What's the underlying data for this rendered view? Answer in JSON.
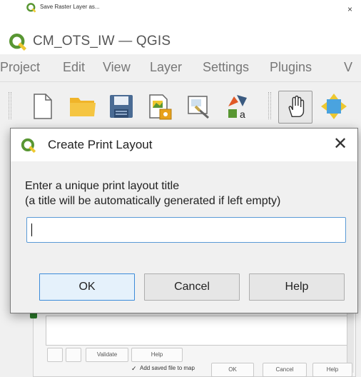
{
  "background_window": {
    "title": "Save Raster Layer as...",
    "close_glyph": "×",
    "buttons": {
      "validate": "Validate",
      "help_small": "Help",
      "ok": "OK",
      "cancel": "Cancel",
      "help": "Help"
    },
    "add_saved_file_checkbox": {
      "label": "Add saved file to map",
      "checked": true,
      "glyph": "✓"
    }
  },
  "qgis_window": {
    "title": "CM_OTS_IW — QGIS",
    "menu": [
      {
        "label": "Project"
      },
      {
        "label": "Edit"
      },
      {
        "label": "View"
      },
      {
        "label": "Layer"
      },
      {
        "label": "Settings"
      },
      {
        "label": "Plugins"
      },
      {
        "label": "V"
      }
    ],
    "toolbar_icons": [
      "new-project-icon",
      "open-project-icon",
      "save-project-icon",
      "new-print-layout-icon",
      "show-layout-manager-icon",
      "style-manager-icon",
      "pan-map-icon",
      "pan-to-selection-icon"
    ]
  },
  "dialog": {
    "title": "Create Print Layout",
    "close_glyph": "✕",
    "prompt_line1": "Enter a unique print layout title",
    "prompt_line2": "(a title will be automatically generated if left empty)",
    "input_value": "",
    "ok_label": "OK",
    "cancel_label": "Cancel",
    "help_label": "Help"
  },
  "colors": {
    "qgis_green": "#589632",
    "qgis_yellow": "#eec82f",
    "focus_blue": "#3c8bd9",
    "dialog_bg": "#f0f0f0"
  }
}
